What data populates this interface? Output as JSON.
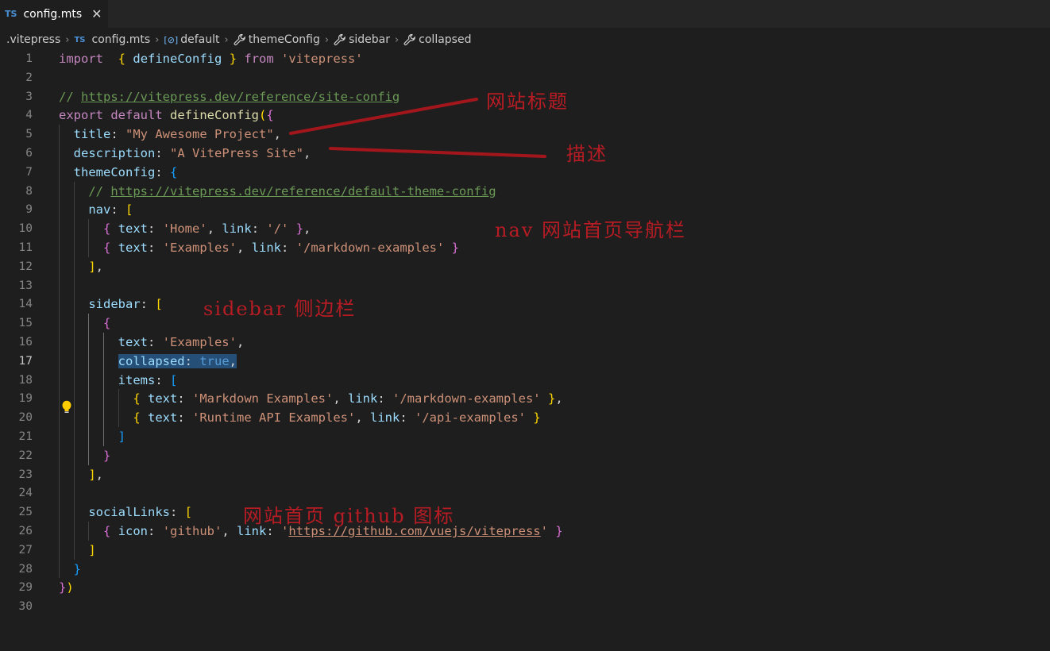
{
  "tab": {
    "lang_badge": "TS",
    "label": "config.mts",
    "close_glyph": "✕"
  },
  "breadcrumb": [
    {
      "label": ".vitepress",
      "icon": ""
    },
    {
      "label": "config.mts",
      "icon": "typescript-file-icon",
      "badge": "TS"
    },
    {
      "label": "default",
      "icon": "symbol-variable-icon",
      "badge": "[⊘]"
    },
    {
      "label": "themeConfig",
      "icon": "wrench-icon"
    },
    {
      "label": "sidebar",
      "icon": "wrench-icon"
    },
    {
      "label": "collapsed",
      "icon": "wrench-icon"
    }
  ],
  "editor": {
    "active_line": 17,
    "line_numbers": [
      "1",
      "2",
      "3",
      "4",
      "5",
      "6",
      "7",
      "8",
      "9",
      "10",
      "11",
      "12",
      "13",
      "14",
      "15",
      "16",
      "17",
      "18",
      "19",
      "20",
      "21",
      "22",
      "23",
      "24",
      "25",
      "26",
      "27",
      "28",
      "29",
      "30"
    ],
    "lightbulb_icon": "lightbulb-icon",
    "code_lines": [
      [
        [
          "kw",
          "import"
        ],
        [
          "",
          "  "
        ],
        [
          "b1",
          "{"
        ],
        [
          "",
          " "
        ],
        [
          "pr",
          "defineConfig"
        ],
        [
          "",
          " "
        ],
        [
          "b1",
          "}"
        ],
        [
          "",
          " "
        ],
        [
          "kw",
          "from"
        ],
        [
          "",
          " "
        ],
        [
          "str",
          "'vitepress'"
        ]
      ],
      [],
      [
        [
          "cm",
          "// "
        ],
        [
          "cm lnk",
          "https://vitepress.dev/reference/site-config"
        ]
      ],
      [
        [
          "kw",
          "export"
        ],
        [
          "",
          " "
        ],
        [
          "kw",
          "default"
        ],
        [
          "",
          " "
        ],
        [
          "fn",
          "defineConfig"
        ],
        [
          "b1",
          "("
        ],
        [
          "b2",
          "{"
        ]
      ],
      [
        [
          "",
          "  "
        ],
        [
          "pr",
          "title"
        ],
        [
          "",
          ": "
        ],
        [
          "str",
          "\"My Awesome Project\""
        ],
        [
          "",
          ","
        ]
      ],
      [
        [
          "",
          "  "
        ],
        [
          "pr",
          "description"
        ],
        [
          "",
          ": "
        ],
        [
          "str",
          "\"A VitePress Site\""
        ],
        [
          "",
          ","
        ]
      ],
      [
        [
          "",
          "  "
        ],
        [
          "pr",
          "themeConfig"
        ],
        [
          "",
          ": "
        ],
        [
          "b3",
          "{"
        ]
      ],
      [
        [
          "",
          "    "
        ],
        [
          "cm",
          "// "
        ],
        [
          "cm lnk",
          "https://vitepress.dev/reference/default-theme-config"
        ]
      ],
      [
        [
          "",
          "    "
        ],
        [
          "pr",
          "nav"
        ],
        [
          "",
          ": "
        ],
        [
          "b1",
          "["
        ]
      ],
      [
        [
          "",
          "      "
        ],
        [
          "b2",
          "{"
        ],
        [
          "",
          " "
        ],
        [
          "pr",
          "text"
        ],
        [
          "",
          ": "
        ],
        [
          "str",
          "'Home'"
        ],
        [
          "",
          ", "
        ],
        [
          "pr",
          "link"
        ],
        [
          "",
          ": "
        ],
        [
          "str",
          "'/'"
        ],
        [
          "",
          " "
        ],
        [
          "b2",
          "}"
        ],
        [
          "",
          ","
        ]
      ],
      [
        [
          "",
          "      "
        ],
        [
          "b2",
          "{"
        ],
        [
          "",
          " "
        ],
        [
          "pr",
          "text"
        ],
        [
          "",
          ": "
        ],
        [
          "str",
          "'Examples'"
        ],
        [
          "",
          ", "
        ],
        [
          "pr",
          "link"
        ],
        [
          "",
          ": "
        ],
        [
          "str",
          "'/markdown-examples'"
        ],
        [
          "",
          " "
        ],
        [
          "b2",
          "}"
        ]
      ],
      [
        [
          "",
          "    "
        ],
        [
          "b1",
          "]"
        ],
        [
          "",
          ","
        ]
      ],
      [],
      [
        [
          "",
          "    "
        ],
        [
          "pr",
          "sidebar"
        ],
        [
          "",
          ": "
        ],
        [
          "b1",
          "["
        ]
      ],
      [
        [
          "",
          "      "
        ],
        [
          "b2",
          "{"
        ]
      ],
      [
        [
          "",
          "        "
        ],
        [
          "pr",
          "text"
        ],
        [
          "",
          ": "
        ],
        [
          "str",
          "'Examples'"
        ],
        [
          "",
          ","
        ]
      ],
      [
        [
          "",
          "        "
        ],
        [
          "pr sel",
          "collapsed"
        ],
        [
          "sel",
          ": "
        ],
        [
          "st sel",
          "true"
        ],
        [
          "sel",
          ","
        ]
      ],
      [
        [
          "",
          "        "
        ],
        [
          "pr",
          "items"
        ],
        [
          "",
          ": "
        ],
        [
          "b3",
          "["
        ]
      ],
      [
        [
          "",
          "          "
        ],
        [
          "b1",
          "{"
        ],
        [
          "",
          " "
        ],
        [
          "pr",
          "text"
        ],
        [
          "",
          ": "
        ],
        [
          "str",
          "'Markdown Examples'"
        ],
        [
          "",
          ", "
        ],
        [
          "pr",
          "link"
        ],
        [
          "",
          ": "
        ],
        [
          "str",
          "'/markdown-examples'"
        ],
        [
          "",
          " "
        ],
        [
          "b1",
          "}"
        ],
        [
          "",
          ","
        ]
      ],
      [
        [
          "",
          "          "
        ],
        [
          "b1",
          "{"
        ],
        [
          "",
          " "
        ],
        [
          "pr",
          "text"
        ],
        [
          "",
          ": "
        ],
        [
          "str",
          "'Runtime API Examples'"
        ],
        [
          "",
          ", "
        ],
        [
          "pr",
          "link"
        ],
        [
          "",
          ": "
        ],
        [
          "str",
          "'/api-examples'"
        ],
        [
          "",
          " "
        ],
        [
          "b1",
          "}"
        ]
      ],
      [
        [
          "",
          "        "
        ],
        [
          "b3",
          "]"
        ]
      ],
      [
        [
          "",
          "      "
        ],
        [
          "b2",
          "}"
        ]
      ],
      [
        [
          "",
          "    "
        ],
        [
          "b1",
          "]"
        ],
        [
          "",
          ","
        ]
      ],
      [],
      [
        [
          "",
          "    "
        ],
        [
          "pr",
          "socialLinks"
        ],
        [
          "",
          ": "
        ],
        [
          "b1",
          "["
        ]
      ],
      [
        [
          "",
          "      "
        ],
        [
          "b2",
          "{"
        ],
        [
          "",
          " "
        ],
        [
          "pr",
          "icon"
        ],
        [
          "",
          ": "
        ],
        [
          "str",
          "'github'"
        ],
        [
          "",
          ", "
        ],
        [
          "pr",
          "link"
        ],
        [
          "",
          ": "
        ],
        [
          "str",
          "'"
        ],
        [
          "str lnk",
          "https://github.com/vuejs/vitepress"
        ],
        [
          "str",
          "'"
        ],
        [
          "",
          " "
        ],
        [
          "b2",
          "}"
        ]
      ],
      [
        [
          "",
          "    "
        ],
        [
          "b1",
          "]"
        ]
      ],
      [
        [
          "",
          "  "
        ],
        [
          "b3",
          "}"
        ]
      ],
      [
        [
          "b2",
          "}"
        ],
        [
          "b1",
          ")"
        ]
      ],
      []
    ]
  },
  "annotations": {
    "title": "网站标题",
    "description": "描述",
    "nav": "nav 网站首页导航栏",
    "sidebar": "sidebar 侧边栏",
    "social": "网站首页 github 图标"
  },
  "colors": {
    "annotation_red": "#b71c24",
    "editor_bg": "#1e1e1e",
    "tabbar_bg": "#252526",
    "selection": "#264f78"
  }
}
